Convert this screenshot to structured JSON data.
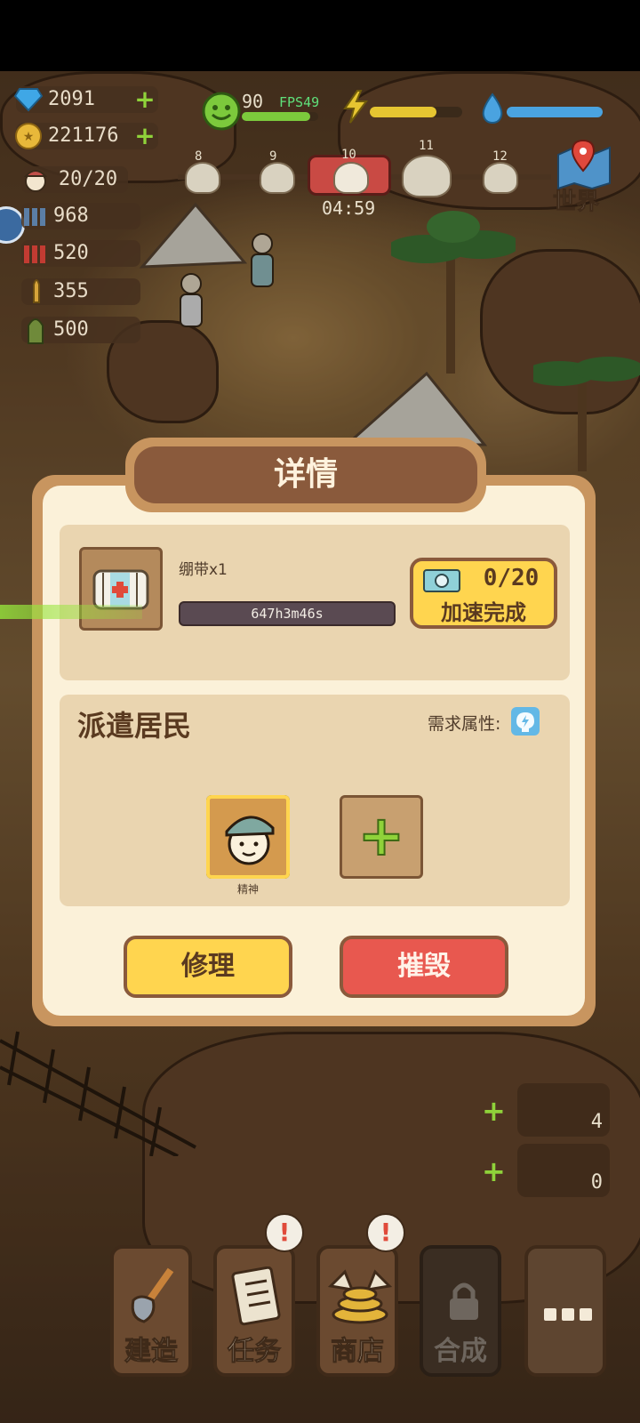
{
  "resources": {
    "diamond": "2091",
    "gold": "221176",
    "population": "20/20",
    "ammo_a": "968",
    "ammo_b": "520",
    "ammo_c": "355",
    "ammo_d": "500"
  },
  "status": {
    "mood": "90",
    "fps": "FPS49"
  },
  "waves": {
    "items": [
      "8",
      "9",
      "10",
      "11",
      "12"
    ],
    "timer": "04:59"
  },
  "world_label": "世界",
  "side_counts": [
    "4",
    "0"
  ],
  "bottom_nav": {
    "build": "建造",
    "task": "任务",
    "shop": "商店",
    "craft": "合成"
  },
  "dialog": {
    "title": "详情",
    "item_name": "绷带x1",
    "timer": "647h3m46s",
    "ticket_count": "0/20",
    "speedup": "加速完成",
    "dispatch_title": "派遣居民",
    "requirement_label": "需求属性:",
    "resident_attr": "精神",
    "repair": "修理",
    "destroy": "摧毁"
  },
  "colors": {
    "accent_yellow": "#ffd54f",
    "danger_red": "#e8584f",
    "panel_brown": "#8a5a3c"
  }
}
